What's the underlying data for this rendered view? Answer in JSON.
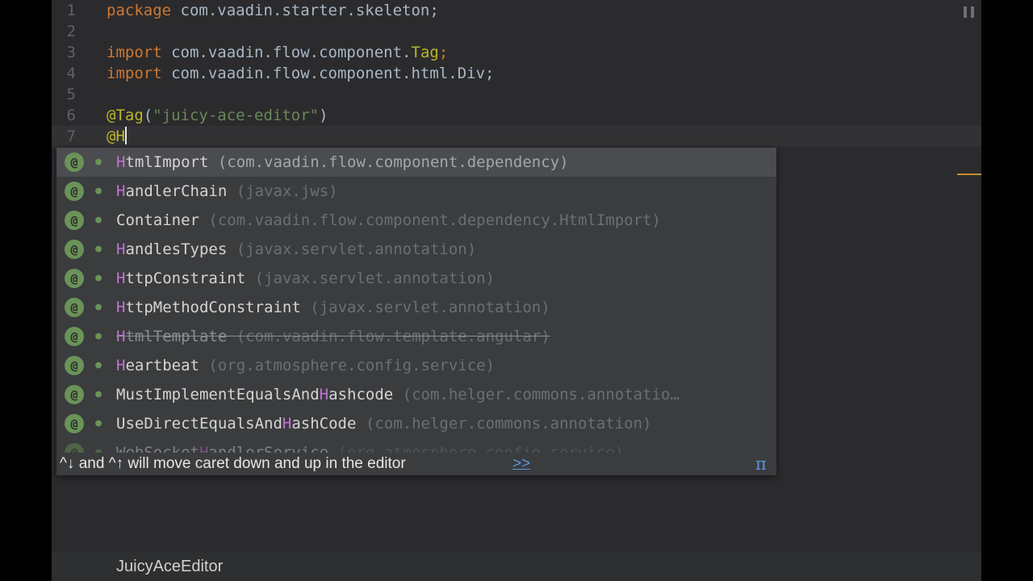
{
  "editor": {
    "lines": [
      {
        "num": "1",
        "parts": [
          {
            "t": "package",
            "c": "kw"
          },
          {
            "t": " com.vaadin.starter.skeleton;",
            "c": ""
          }
        ]
      },
      {
        "num": "2",
        "parts": []
      },
      {
        "num": "3",
        "parts": [
          {
            "t": "import",
            "c": "kw"
          },
          {
            "t": " com.vaadin.flow.component.",
            "c": ""
          },
          {
            "t": "Tag",
            "c": "ann"
          },
          {
            "t": ";",
            "c": "kw"
          }
        ]
      },
      {
        "num": "4",
        "parts": [
          {
            "t": "import",
            "c": "kw"
          },
          {
            "t": " com.vaadin.flow.component.html.Div;",
            "c": ""
          }
        ]
      },
      {
        "num": "5",
        "parts": []
      },
      {
        "num": "6",
        "parts": [
          {
            "t": "@Tag",
            "c": "ann"
          },
          {
            "t": "(",
            "c": ""
          },
          {
            "t": "\"juicy-ace-editor\"",
            "c": "str"
          },
          {
            "t": ")",
            "c": ""
          }
        ]
      },
      {
        "num": "7",
        "parts": [
          {
            "t": "@H",
            "c": "ann"
          }
        ],
        "current": true
      }
    ]
  },
  "completion": {
    "items": [
      {
        "match": "H",
        "rest": "tmlImport",
        "pkg": "(com.vaadin.flow.component.dependency)",
        "selected": true
      },
      {
        "match": "H",
        "rest": "andlerChain",
        "pkg": "(javax.jws)"
      },
      {
        "pre": "Container",
        "match": "",
        "rest": "",
        "pkg": "(com.vaadin.flow.component.dependency.HtmlImport)"
      },
      {
        "match": "H",
        "rest": "andlesTypes",
        "pkg": "(javax.servlet.annotation)"
      },
      {
        "match": "H",
        "rest": "ttpConstraint",
        "pkg": "(javax.servlet.annotation)"
      },
      {
        "match": "H",
        "rest": "ttpMethodConstraint",
        "pkg": "(javax.servlet.annotation)"
      },
      {
        "match": "H",
        "rest": "tmlTemplate",
        "pkg": "(com.vaadin.flow.template.angular)",
        "deprecated": true
      },
      {
        "match": "H",
        "rest": "eartbeat",
        "pkg": "(org.atmosphere.config.service)"
      },
      {
        "pre": "MustImplementEqualsAnd",
        "match": "H",
        "rest": "ashcode",
        "pkg": "(com.helger.commons.annotatio…"
      },
      {
        "pre": "UseDirectEqualsAnd",
        "match": "H",
        "rest": "ashCode",
        "pkg": "(com.helger.commons.annotation)"
      },
      {
        "pre": "WebSocket",
        "match": "H",
        "rest": "andlerService",
        "pkg": "(org.atmosphere.config.service)",
        "faded": true
      }
    ],
    "hint_text": "^↓ and ^↑ will move caret down and up in the editor",
    "hint_link": ">>",
    "pi": "π"
  },
  "statusbar": {
    "file": "JuicyAceEditor"
  },
  "colors": {
    "keyword": "#cc7832",
    "annotation": "#bbb529",
    "string": "#6a8759",
    "match_highlight": "#c471d6",
    "link": "#5c95e0"
  },
  "icons": {
    "annotation_icon": "at-icon",
    "visibility_icon": "leaf-icon",
    "pause_icon": "pause-icon",
    "pi_icon": "pi-icon"
  }
}
